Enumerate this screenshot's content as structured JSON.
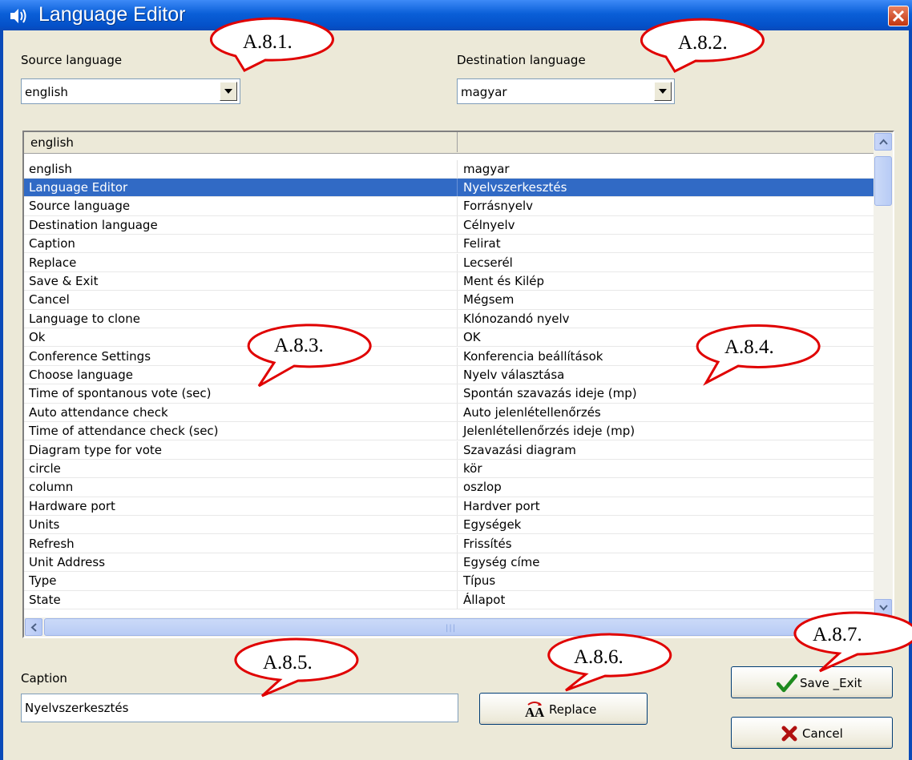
{
  "window": {
    "title": "Language Editor"
  },
  "source": {
    "label": "Source language",
    "value": "english"
  },
  "destination": {
    "label": "Destination language",
    "value": "magyar"
  },
  "grid": {
    "headers": [
      "english",
      ""
    ],
    "selected_index": 1,
    "rows": [
      [
        "english",
        "magyar"
      ],
      [
        "Language Editor",
        "Nyelvszerkesztés"
      ],
      [
        "Source language",
        "Forrásnyelv"
      ],
      [
        "Destination language",
        "Célnyelv"
      ],
      [
        "Caption",
        "Felirat"
      ],
      [
        "Replace",
        "Lecserél"
      ],
      [
        "Save & Exit",
        "Ment és Kilép"
      ],
      [
        "Cancel",
        "Mégsem"
      ],
      [
        "Language to clone",
        "Klónozandó nyelv"
      ],
      [
        "Ok",
        "OK"
      ],
      [
        "Conference Settings",
        "Konferencia beállítások"
      ],
      [
        "Choose language",
        "Nyelv választása"
      ],
      [
        "Time of spontanous vote (sec)",
        "Spontán szavazás ideje (mp)"
      ],
      [
        "Auto attendance check",
        "Auto jelenlétellenőrzés"
      ],
      [
        "Time of attendance check (sec)",
        "Jelenlétellenőrzés ideje (mp)"
      ],
      [
        "Diagram type for vote",
        "Szavazási diagram"
      ],
      [
        "circle",
        "kör"
      ],
      [
        "column",
        "oszlop"
      ],
      [
        "Hardware port",
        "Hardver port"
      ],
      [
        "Units",
        "Egységek"
      ],
      [
        "Refresh",
        "Frissítés"
      ],
      [
        "Unit Address",
        "Egység címe"
      ],
      [
        "Type",
        "Típus"
      ],
      [
        "State",
        "Állapot"
      ]
    ]
  },
  "caption": {
    "label": "Caption",
    "value": "Nyelvszerkesztés"
  },
  "buttons": {
    "replace": "Replace",
    "save_exit": "Save _Exit",
    "cancel": "Cancel"
  },
  "callouts": [
    "A.8.1.",
    "A.8.2.",
    "A.8.3.",
    "A.8.4.",
    "A.8.5.",
    "A.8.6.",
    "A.8.7."
  ]
}
